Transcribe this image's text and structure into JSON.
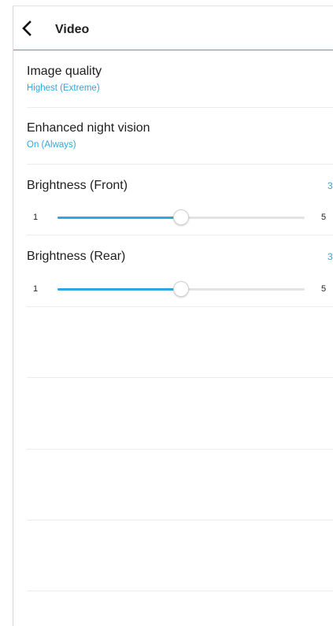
{
  "header": {
    "title": "Video",
    "back_icon": "chevron-left-icon"
  },
  "settings": [
    {
      "label": "Image quality",
      "value": "Highest (Extreme)"
    },
    {
      "label": "Enhanced night vision",
      "value": "On (Always)"
    }
  ],
  "sliders": [
    {
      "label": "Brightness (Front)",
      "current": "3",
      "min": "1",
      "max": "5",
      "level": 3
    },
    {
      "label": "Brightness (Rear)",
      "current": "3",
      "min": "1",
      "max": "5",
      "level": 3
    }
  ],
  "colors": {
    "accent": "#2fa7df",
    "text": "#1e1e1e",
    "divider": "#ececec"
  }
}
